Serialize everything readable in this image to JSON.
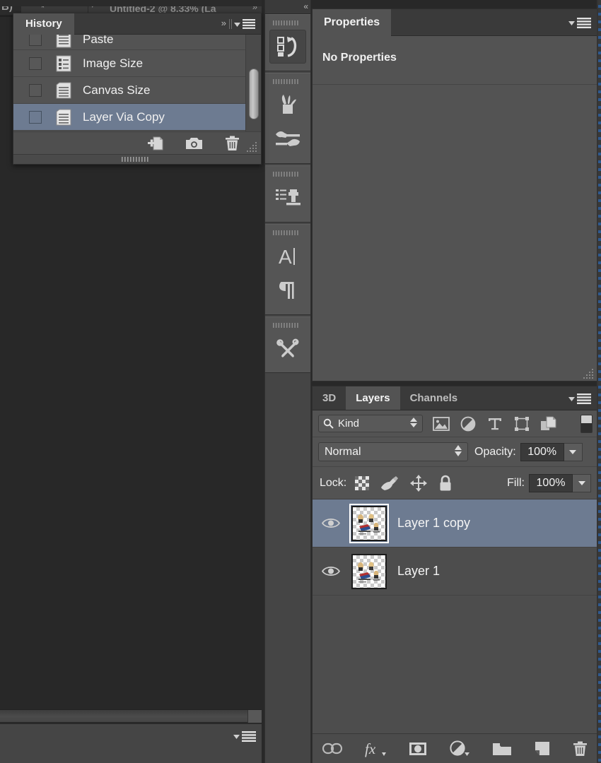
{
  "app": "Adobe Photoshop",
  "document_tab": {
    "left_fragment": "B)",
    "dirty_marker": "*",
    "title": "Untitled-2 @ 8.33% (La",
    "chevron_icon": "chevron-down-icon",
    "collapse_icon": "double-chevron-right-icon"
  },
  "history_panel": {
    "tab_label": "History",
    "forward_icon": "double-chevron-right-icon",
    "menu_icon": "panel-menu-icon",
    "items": [
      {
        "label": "Paste",
        "icon": "history-state-icon",
        "selected": false,
        "snapshot_checked": false,
        "clipped": true
      },
      {
        "label": "Image Size",
        "icon": "image-size-icon",
        "selected": false,
        "snapshot_checked": false,
        "clipped": false
      },
      {
        "label": "Canvas Size",
        "icon": "canvas-size-icon",
        "selected": false,
        "snapshot_checked": false,
        "clipped": false
      },
      {
        "label": "Layer Via Copy",
        "icon": "layer-via-copy-icon",
        "selected": true,
        "snapshot_checked": false,
        "clipped": false
      }
    ],
    "footer_buttons": [
      {
        "name": "create-document-from-state-button",
        "icon": "new-document-icon"
      },
      {
        "name": "create-new-snapshot-button",
        "icon": "camera-icon"
      },
      {
        "name": "delete-state-button",
        "icon": "trash-icon"
      }
    ],
    "resize_grip": "resize-grip-icon"
  },
  "dock": {
    "collapse_icon": "double-chevron-left-icon",
    "groups": [
      {
        "buttons": [
          {
            "name": "dock-icon-history",
            "icon": "history-panel-icon",
            "active": true
          }
        ]
      },
      {
        "buttons": [
          {
            "name": "dock-icon-brush-presets",
            "icon": "brush-presets-icon",
            "active": false
          },
          {
            "name": "dock-icon-brush",
            "icon": "brush-icon",
            "active": false
          }
        ]
      },
      {
        "buttons": [
          {
            "name": "dock-icon-clone-source",
            "icon": "clone-source-icon",
            "active": false
          }
        ]
      },
      {
        "buttons": [
          {
            "name": "dock-icon-character",
            "icon": "character-icon",
            "active": false
          },
          {
            "name": "dock-icon-paragraph",
            "icon": "paragraph-icon",
            "active": false
          }
        ]
      },
      {
        "buttons": [
          {
            "name": "dock-icon-tool-presets",
            "icon": "tool-presets-icon",
            "active": false
          }
        ]
      },
      {
        "buttons": [
          {
            "name": "dock-icon-creative-cloud",
            "icon": "creative-cloud-icon",
            "active": false
          }
        ]
      }
    ]
  },
  "properties_panel": {
    "tab_label": "Properties",
    "empty_message": "No Properties",
    "menu_icon": "panel-menu-icon",
    "resize_grip": "resize-grip-icon"
  },
  "layers_panel": {
    "tabs": [
      {
        "label": "3D",
        "active": false,
        "name": "tab-3d"
      },
      {
        "label": "Layers",
        "active": true,
        "name": "tab-layers"
      },
      {
        "label": "Channels",
        "active": false,
        "name": "tab-channels"
      }
    ],
    "menu_icon": "panel-menu-icon",
    "filter": {
      "type_label": "Kind",
      "search_icon": "search-icon",
      "stepper_icon": "stepper-arrows-icon",
      "icons": [
        {
          "name": "filter-pixel-layers-icon",
          "icon": "image-icon"
        },
        {
          "name": "filter-adjustment-layers-icon",
          "icon": "adjustment-circle-icon"
        },
        {
          "name": "filter-type-layers-icon",
          "icon": "type-T-icon"
        },
        {
          "name": "filter-shape-layers-icon",
          "icon": "shape-bounds-icon"
        },
        {
          "name": "filter-smart-objects-icon",
          "icon": "smart-object-icon"
        }
      ],
      "toggle_name": "filter-enable-toggle"
    },
    "blend_mode": "Normal",
    "opacity_label": "Opacity:",
    "opacity_value": "100%",
    "fill_label": "Fill:",
    "fill_value": "100%",
    "lock_label": "Lock:",
    "lock_icons": [
      {
        "name": "lock-transparent-pixels-button",
        "icon": "checkerboard-icon"
      },
      {
        "name": "lock-image-pixels-button",
        "icon": "brush-icon"
      },
      {
        "name": "lock-position-button",
        "icon": "move-arrows-icon"
      },
      {
        "name": "lock-all-button",
        "icon": "padlock-icon"
      }
    ],
    "layers": [
      {
        "name": "Layer 1 copy",
        "visible": true,
        "selected": true,
        "thumbnail": "transparent-artwork-thumbnail"
      },
      {
        "name": "Layer 1",
        "visible": true,
        "selected": false,
        "thumbnail": "transparent-artwork-thumbnail"
      }
    ],
    "footer_buttons": [
      {
        "name": "link-layers-button",
        "icon": "link-icon"
      },
      {
        "name": "add-layer-style-button",
        "icon": "fx-icon"
      },
      {
        "name": "add-layer-mask-button",
        "icon": "layer-mask-icon"
      },
      {
        "name": "new-adjustment-layer-button",
        "icon": "adjustment-circle-icon"
      },
      {
        "name": "new-group-button",
        "icon": "folder-icon"
      },
      {
        "name": "new-layer-button",
        "icon": "new-layer-icon"
      },
      {
        "name": "delete-layer-button",
        "icon": "trash-icon"
      }
    ]
  },
  "bottom_panel": {
    "menu_icon": "panel-menu-icon"
  },
  "colors": {
    "panel_bg": "#535353",
    "panel_header": "#3a3a3a",
    "canvas_bg": "#282828",
    "selection_blue": "#6d7b91",
    "text": "#f0f0f0",
    "dock_bg": "#454545"
  }
}
